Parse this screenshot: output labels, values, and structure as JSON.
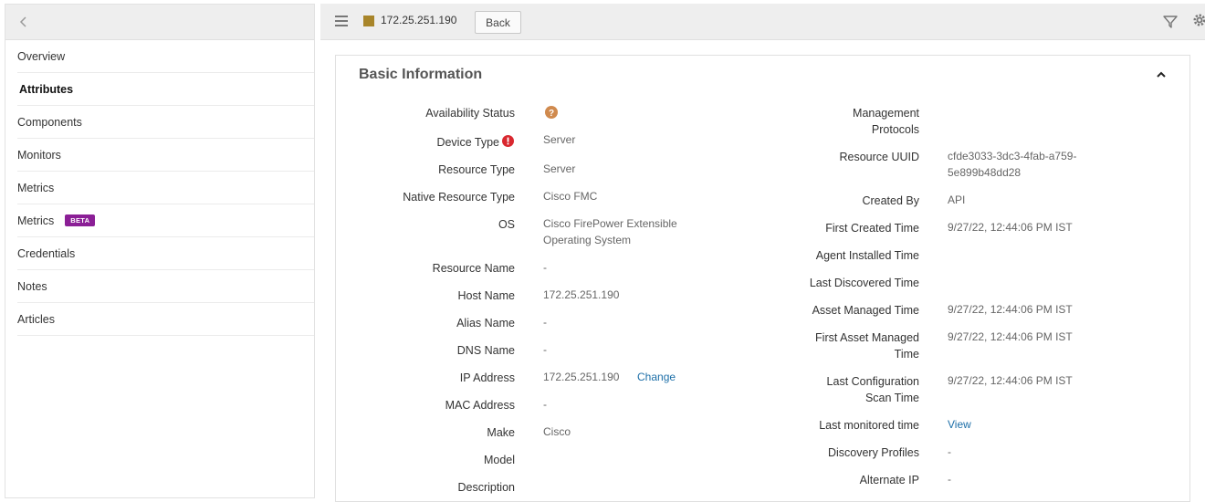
{
  "sidebar": {
    "items": [
      {
        "label": "Overview"
      },
      {
        "label": "Attributes"
      },
      {
        "label": "Components"
      },
      {
        "label": "Monitors"
      },
      {
        "label": "Metrics"
      },
      {
        "label": "Metrics",
        "badge": "BETA"
      },
      {
        "label": "Credentials"
      },
      {
        "label": "Notes"
      },
      {
        "label": "Articles"
      }
    ]
  },
  "topbar": {
    "resource_ip": "172.25.251.190",
    "back_label": "Back",
    "swatch_color": "#a8852a"
  },
  "panel": {
    "title": "Basic Information"
  },
  "left_fields": {
    "availability_status": {
      "label": "Availability Status",
      "value": ""
    },
    "device_type": {
      "label": "Device Type",
      "value": "Server"
    },
    "resource_type": {
      "label": "Resource Type",
      "value": "Server"
    },
    "native_resource_type": {
      "label": "Native Resource Type",
      "value": "Cisco FMC"
    },
    "os": {
      "label": "OS",
      "value": "Cisco FirePower Extensible Operating System"
    },
    "resource_name": {
      "label": "Resource Name",
      "value": "-"
    },
    "host_name": {
      "label": "Host Name",
      "value": "172.25.251.190"
    },
    "alias_name": {
      "label": "Alias Name",
      "value": "-"
    },
    "dns_name": {
      "label": "DNS Name",
      "value": "-"
    },
    "ip_address": {
      "label": "IP Address",
      "value": "172.25.251.190",
      "action": "Change"
    },
    "mac_address": {
      "label": "MAC Address",
      "value": "-"
    },
    "make": {
      "label": "Make",
      "value": "Cisco"
    },
    "model": {
      "label": "Model",
      "value": ""
    },
    "description": {
      "label": "Description",
      "value": ""
    }
  },
  "right_fields": {
    "management_protocols": {
      "label_line1": "Management",
      "label_line2": "Protocols",
      "value": ""
    },
    "resource_uuid": {
      "label": "Resource UUID",
      "value_line1": "cfde3033-3dc3-4fab-a759-",
      "value_line2": "5e899b48dd28"
    },
    "created_by": {
      "label": "Created By",
      "value": "API"
    },
    "first_created_time": {
      "label": "First Created Time",
      "value": "9/27/22, 12:44:06 PM IST"
    },
    "agent_installed_time": {
      "label": "Agent Installed Time",
      "value": ""
    },
    "last_discovered_time": {
      "label": "Last Discovered Time",
      "value": ""
    },
    "asset_managed_time": {
      "label": "Asset Managed Time",
      "value": "9/27/22, 12:44:06 PM IST"
    },
    "first_asset_managed_time": {
      "label_line1": "First Asset Managed",
      "label_line2": "Time",
      "value": "9/27/22, 12:44:06 PM IST"
    },
    "last_configuration_scan_time": {
      "label_line1": "Last Configuration",
      "label_line2": "Scan Time",
      "value": "9/27/22, 12:44:06 PM IST"
    },
    "last_monitored_time": {
      "label": "Last monitored time",
      "value": "View"
    },
    "discovery_profiles": {
      "label": "Discovery Profiles",
      "value": "-"
    },
    "alternate_ip": {
      "label": "Alternate IP",
      "value": "-"
    }
  },
  "colors": {
    "link": "#1d6fa8",
    "help_icon": "#d08a4e",
    "alert_icon": "#d9282f",
    "beta_badge": "#8b1f96"
  }
}
